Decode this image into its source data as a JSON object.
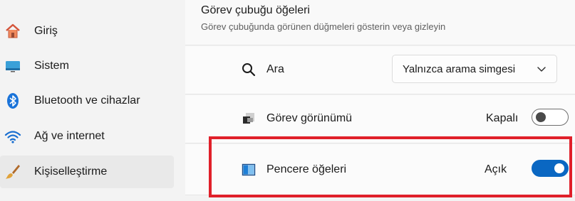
{
  "sidebar": {
    "items": [
      {
        "label": "Giriş",
        "icon": "home-icon"
      },
      {
        "label": "Sistem",
        "icon": "system-monitor-icon"
      },
      {
        "label": "Bluetooth ve cihazlar",
        "icon": "bluetooth-icon"
      },
      {
        "label": "Ağ ve internet",
        "icon": "wifi-icon"
      },
      {
        "label": "Kişiselleştirme",
        "icon": "paintbrush-icon",
        "active": true
      }
    ]
  },
  "section": {
    "title": "Görev çubuğu öğeleri",
    "subtitle": "Görev çubuğunda görünen düğmeleri gösterin veya gizleyin"
  },
  "rows": {
    "search": {
      "label": "Ara",
      "icon": "search-icon",
      "dropdown_value": "Yalnızca arama simgesi"
    },
    "task_view": {
      "label": "Görev görünümü",
      "icon": "task-view-icon",
      "state_label": "Kapalı",
      "toggle_on": false
    },
    "window_items": {
      "label": "Pencere öğeleri",
      "icon": "widgets-icon",
      "state_label": "Açık",
      "toggle_on": true
    }
  },
  "colors": {
    "accent": "#0a67c2",
    "highlight": "#e0202a"
  }
}
